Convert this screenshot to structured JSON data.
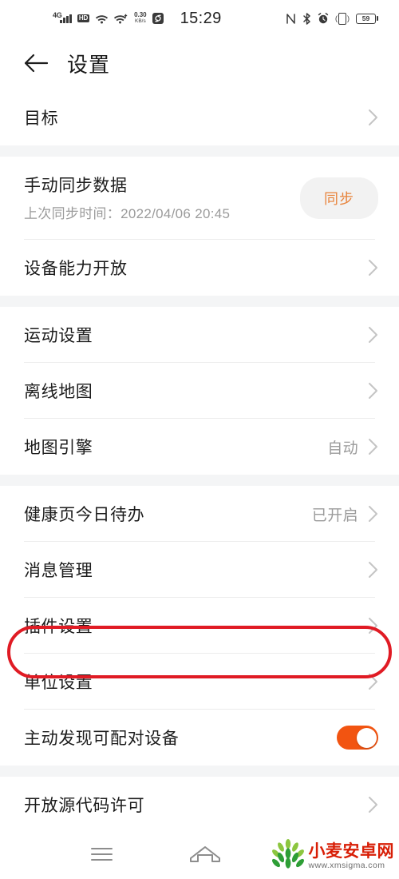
{
  "status_bar": {
    "network_type": "4G",
    "hd_badge": "HD",
    "net_speed_value": "0.30",
    "net_speed_unit": "KB/s",
    "time": "15:29",
    "battery_percent": "59",
    "icons": [
      "signal-bars-icon",
      "hd-icon",
      "wifi-icon",
      "wifi-plus-icon",
      "net-speed-icon",
      "data-saver-icon",
      "nfc-icon",
      "bluetooth-icon",
      "alarm-icon",
      "vibrate-icon",
      "battery-icon"
    ]
  },
  "header": {
    "title": "设置",
    "back_icon": "back-arrow-icon"
  },
  "sections": [
    {
      "rows": [
        {
          "label": "目标",
          "type": "link"
        }
      ]
    },
    {
      "rows": [
        {
          "label": "手动同步数据",
          "sub": "上次同步时间：2022/04/06 20:45",
          "type": "button",
          "button_label": "同步"
        },
        {
          "label": "设备能力开放",
          "type": "link"
        }
      ]
    },
    {
      "rows": [
        {
          "label": "运动设置",
          "type": "link"
        },
        {
          "label": "离线地图",
          "type": "link"
        },
        {
          "label": "地图引擎",
          "value": "自动",
          "type": "link"
        }
      ]
    },
    {
      "rows": [
        {
          "label": "健康页今日待办",
          "value": "已开启",
          "type": "link"
        },
        {
          "label": "消息管理",
          "type": "link",
          "highlighted": true
        },
        {
          "label": "插件设置",
          "type": "link"
        },
        {
          "label": "单位设置",
          "type": "link"
        },
        {
          "label": "主动发现可配对设备",
          "type": "toggle",
          "toggle_on": true
        }
      ]
    },
    {
      "rows": [
        {
          "label": "开放源代码许可",
          "type": "link"
        }
      ]
    }
  ],
  "nav_bar": {
    "menu_icon": "hamburger-menu-icon",
    "home_icon": "home-icon"
  },
  "watermark": {
    "title": "小麦安卓网",
    "url": "www.xmsigma.com",
    "logo": "wheat-logo-icon"
  },
  "colors": {
    "accent_orange": "#f25411",
    "sync_text": "#e8833a",
    "highlight_red": "#e01b24",
    "watermark_red": "#d81e06",
    "section_gap": "#f4f5f6"
  }
}
